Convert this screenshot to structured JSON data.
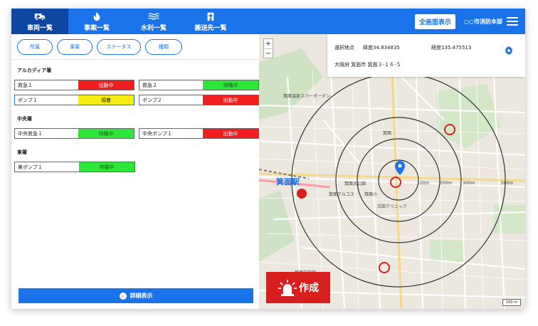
{
  "header": {
    "tabs": [
      {
        "label": "車両一覧",
        "icon": "ambulance-icon",
        "active": true
      },
      {
        "label": "事案一覧",
        "icon": "fire-icon",
        "active": false
      },
      {
        "label": "水利一覧",
        "icon": "water-icon",
        "active": false
      },
      {
        "label": "搬送先一覧",
        "icon": "hospital-icon",
        "active": false
      }
    ],
    "fullscreen_label": "全画面表示",
    "org_name": "○○市消防本部"
  },
  "filters": [
    "所属",
    "事案",
    "ステータス",
    "種類"
  ],
  "stations": [
    {
      "name": "アルカディア署",
      "units": [
        {
          "name": "救急１",
          "status": "出動中",
          "color": "red"
        },
        {
          "name": "救急２",
          "status": "待機中",
          "color": "green"
        },
        {
          "name": "ポンプ１",
          "status": "現着",
          "color": "yellow",
          "selected": true
        },
        {
          "name": "ポンプ２",
          "status": "出動中",
          "color": "red"
        }
      ]
    },
    {
      "name": "中央署",
      "units": [
        {
          "name": "中央救急１",
          "status": "待機中",
          "color": "green"
        },
        {
          "name": "中央ポンプ１",
          "status": "出動中",
          "color": "red"
        }
      ]
    },
    {
      "name": "東署",
      "units": [
        {
          "name": "東ポンプ１",
          "status": "待機中",
          "color": "green"
        }
      ]
    }
  ],
  "details_label": "詳細表示",
  "map": {
    "zoom_in": "+",
    "zoom_out": "−",
    "selected_label": "選択地点",
    "latitude": "緯度34.834835",
    "longitude": "経度135.475513",
    "address": "大阪府 箕面市 箕面３-１６-５",
    "create_label": "作成",
    "scale": "100 m",
    "labels": {
      "station": "箕面駅",
      "ring_100": "100m",
      "ring_200": "200m",
      "ring_300": "300m",
      "ring_500": "500m",
      "park": "箕面北公園",
      "clinic": "古田クリニック",
      "town": "箕面",
      "school": "箕面小",
      "hall": "箕面市役所",
      "pool": "箕面温泉スパーガーデン",
      "apt": "箕面アルコス"
    }
  },
  "colors": {
    "header": "#1a73e8",
    "header_active": "#0d47a1",
    "red": "#f01e1e",
    "green": "#2ee63a",
    "yellow": "#f5ec16",
    "create": "#d71f1f"
  }
}
